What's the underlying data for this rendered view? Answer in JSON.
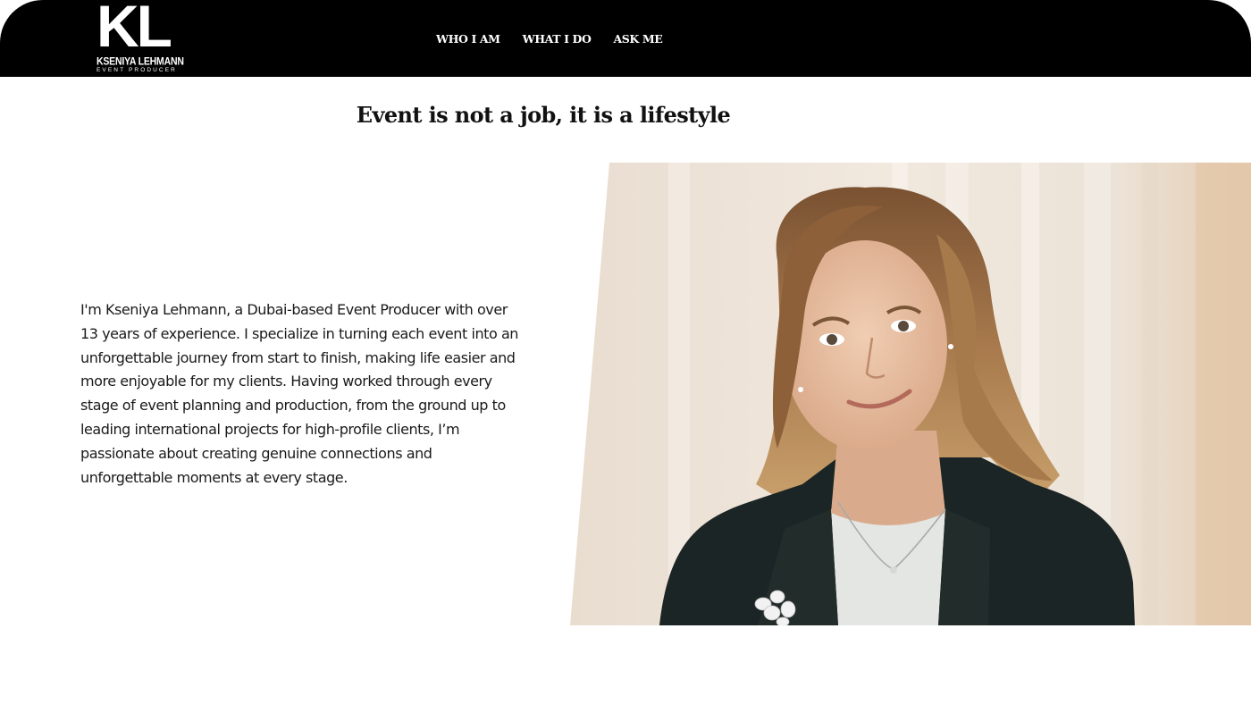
{
  "header": {
    "logo": {
      "mark": "KL",
      "name": "KSENIYA LEHMANN",
      "tagline": "EVENT PRODUCER"
    },
    "nav": [
      {
        "label": "WHO I AM"
      },
      {
        "label": "WHAT I DO"
      },
      {
        "label": "ASK ME"
      }
    ]
  },
  "main": {
    "headline": "Event is not a job, it is a lifestyle",
    "intro": "I'm Kseniya Lehmann, a Dubai-based Event Producer with over 13 years of experience. I specialize in turning each event into an unforgettable journey from start to finish, making life easier and more enjoyable for my clients. Having worked through every stage of event planning and production, from the ground up to leading international projects for high-profile clients, I’m passionate about creating genuine connections and unforgettable moments at every stage."
  },
  "colors": {
    "header_bg": "#000000",
    "header_text": "#ffffff",
    "body_text": "#1a1a1a",
    "page_bg": "#ffffff"
  }
}
